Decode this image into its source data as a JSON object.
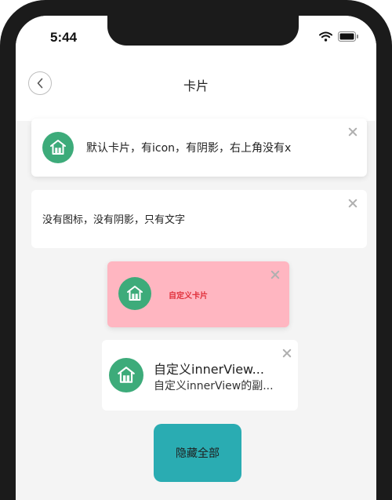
{
  "status_bar": {
    "time": "5:44",
    "icons": [
      "wifi-icon",
      "battery-icon"
    ]
  },
  "nav": {
    "title": "卡片",
    "back_icon": "chevron-left-icon"
  },
  "cards": [
    {
      "text": "默认卡片，有icon，有阴影，右上角没有x",
      "icon": "home-icon",
      "closable": true,
      "shadow": true
    },
    {
      "text": "没有图标，没有阴影，只有文字",
      "closable": true,
      "shadow": false
    },
    {
      "text": "自定义卡片",
      "icon": "home-icon",
      "closable": true,
      "background": "#ffb6c1",
      "text_color": "#e0313c"
    },
    {
      "title": "自定义innerView...",
      "subtitle": "自定义innerView的副...",
      "icon": "home-icon",
      "closable": true
    }
  ],
  "hide_all_button": {
    "label": "隐藏全部"
  },
  "colors": {
    "accent": "#2aacb2",
    "icon_green": "#3dab7a",
    "custom_card_bg": "#ffb6c1",
    "custom_card_text": "#e0313c"
  }
}
